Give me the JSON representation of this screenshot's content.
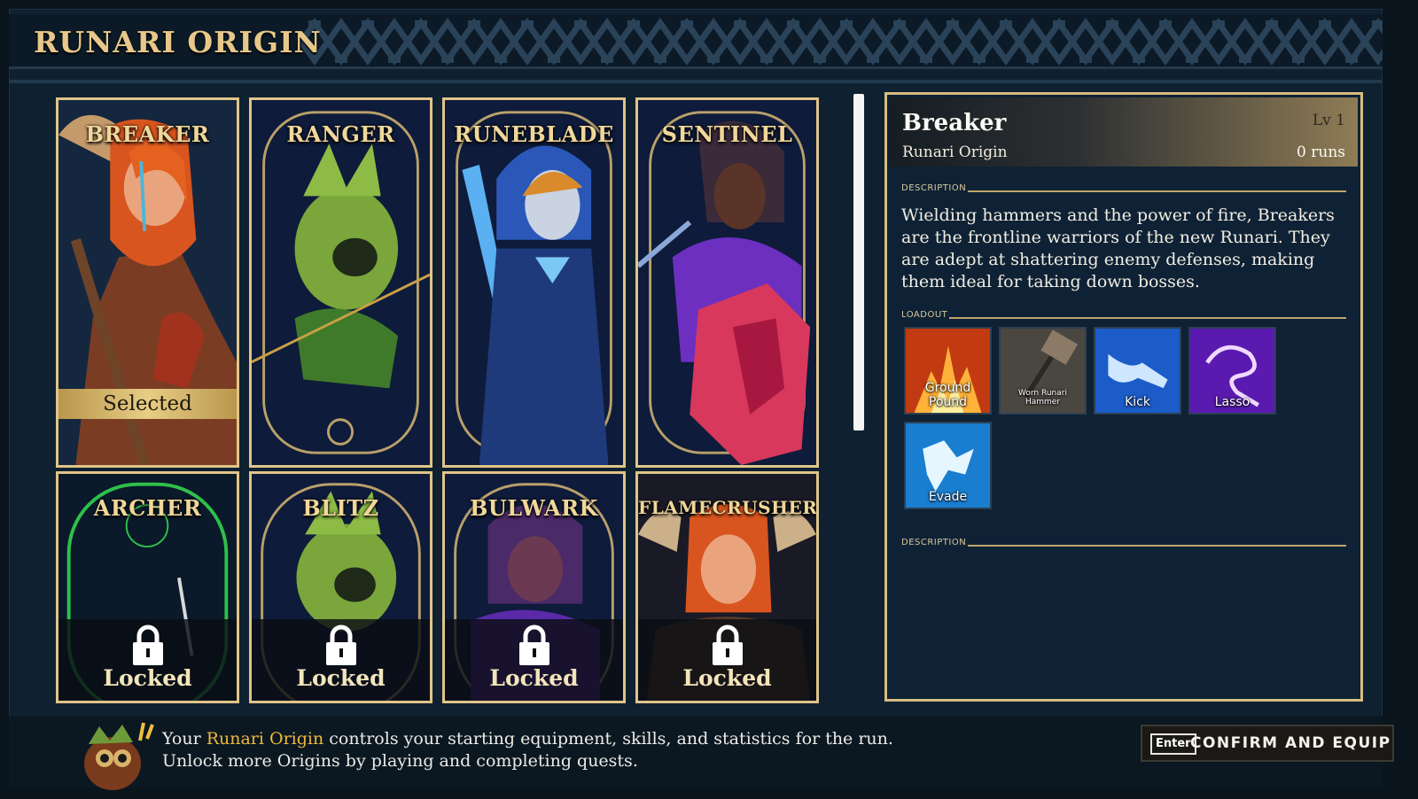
{
  "screen": {
    "title": "RUNARI ORIGIN"
  },
  "origins": [
    {
      "name": "BREAKER",
      "status": "Selected",
      "art": "red-haired-horned-warrior-portrait"
    },
    {
      "name": "RANGER",
      "status": "",
      "art": "green-eyepatch-creature-archer-portrait"
    },
    {
      "name": "RUNEBLADE",
      "status": "",
      "art": "blue-hooded-swordswoman-portrait"
    },
    {
      "name": "SENTINEL",
      "status": "",
      "art": "shield-bearer-with-pink-shield-portrait"
    },
    {
      "name": "ARCHER",
      "status": "Locked",
      "art": "green-silhouette-bow-portrait"
    },
    {
      "name": "BLITZ",
      "status": "Locked",
      "art": "green-eyepatch-creature-portrait"
    },
    {
      "name": "BULWARK",
      "status": "Locked",
      "art": "purple-dreadlocked-warrior-portrait"
    },
    {
      "name": "FLAMECRUSHER",
      "status": "Locked",
      "art": "red-haired-horned-warrior-portrait"
    }
  ],
  "details": {
    "name": "Breaker",
    "origin_label": "Runari Origin",
    "level": "Lv 1",
    "runs": "0 runs",
    "description_heading": "DESCRIPTION",
    "description": "Wielding hammers and the power of fire, Breakers are the frontline warriors of the new Runari. They are adept at shattering enemy defenses, making them ideal for taking down bosses.",
    "loadout_heading": "LOADOUT",
    "loadout": [
      {
        "label": "Ground Pound",
        "icon": "fire-burst-icon"
      },
      {
        "label": "Worn Runari Hammer",
        "icon": "hammer-icon"
      },
      {
        "label": "Kick",
        "icon": "kick-icon"
      },
      {
        "label": "Lasso",
        "icon": "lasso-icon"
      },
      {
        "label": "Evade",
        "icon": "evade-icon"
      }
    ],
    "second_heading": "DESCRIPTION"
  },
  "footer": {
    "hint_before": "Your ",
    "hint_accent": "Runari Origin",
    "hint_after": " controls your starting equipment, skills, and statistics for the run.",
    "hint_line2": "Unlock more Origins by playing and completing quests.",
    "confirm_key": "Enter",
    "confirm_label": "CONFIRM AND EQUIP"
  },
  "colors": {
    "gold": "#e0c48a",
    "accent": "#f0b73a",
    "panel": "#0f2235"
  }
}
